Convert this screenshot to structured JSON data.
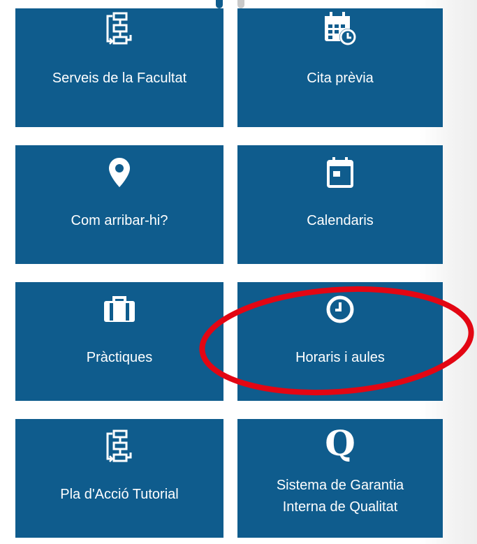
{
  "tiles": [
    {
      "id": "serveis",
      "label": "Serveis de la Facultat",
      "icon": "flowchart-icon"
    },
    {
      "id": "cita",
      "label": "Cita prèvia",
      "icon": "calendar-clock-icon"
    },
    {
      "id": "arribar",
      "label": "Com arribar-hi?",
      "icon": "map-pin-icon"
    },
    {
      "id": "calendaris",
      "label": "Calendaris",
      "icon": "calendar-icon"
    },
    {
      "id": "practiques",
      "label": "Pràctiques",
      "icon": "briefcase-icon"
    },
    {
      "id": "horaris",
      "label": "Horaris i aules",
      "icon": "clock-icon"
    },
    {
      "id": "pat",
      "label": "Pla d'Acció Tutorial",
      "icon": "flowchart-icon"
    },
    {
      "id": "sgiq",
      "label": "Sistema de Garantia Interna de Qualitat",
      "icon": "q-letter-icon",
      "icon_text": "Q"
    }
  ],
  "colors": {
    "tile": "#0f5c8d",
    "text": "#ffffff",
    "highlight": "#e30613",
    "dot_inactive": "#c9c9c9"
  },
  "annotation": {
    "shape": "ellipse",
    "target": "horaris",
    "color": "#e30613"
  }
}
